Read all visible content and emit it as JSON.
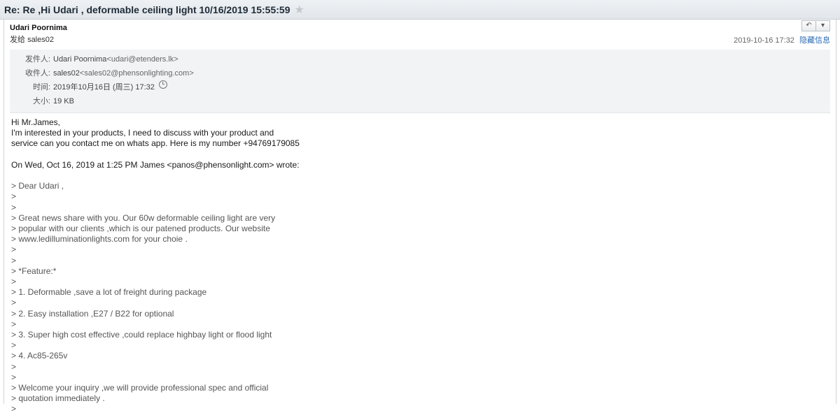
{
  "subject": "Re: Re ,Hi Udari , deformable ceiling light 10/16/2019 15:55:59",
  "header": {
    "from_name": "Udari Poornima",
    "sendto_label": "发给",
    "sendto_value": "sales02",
    "datetime": "2019-10-16 17:32",
    "hide_link": "隐藏信息"
  },
  "details": {
    "from_label": "发件人:",
    "from_name": "Udari Poornima",
    "from_email": "<udari@etenders.lk>",
    "to_label": "收件人:",
    "to_name": "sales02",
    "to_email": "<sales02@phensonlighting.com>",
    "time_label": "时间:",
    "time_value": "2019年10月16日 (周三) 17:32",
    "size_label": "大小:",
    "size_value": "19 KB"
  },
  "icons": {
    "reply": "reply-icon",
    "reply_all": "reply-all-icon",
    "star": "star-icon",
    "clock": "clock-icon"
  },
  "body": {
    "lines": [
      "Hi Mr.James,",
      "I'm interested in your products, I need to discuss with your product and",
      "service can you contact me on whats app. Here is my number +94769179085",
      "",
      "On Wed, Oct 16, 2019 at 1:25 PM James <panos@phensonlight.com> wrote:",
      ""
    ],
    "quote_lines": [
      "> Dear Udari ,",
      ">",
      ">",
      "> Great news share with you. Our 60w deformable ceiling light are very",
      "> popular with our clients ,which is our patened products. Our website",
      "> www.ledilluminationlights.com for your choie .",
      ">",
      ">",
      "> *Feature:*",
      ">",
      "> 1. Deformable ,save a lot of freight during package",
      ">",
      "> 2. Easy installation ,E27 / B22 for optional",
      ">",
      "> 3. Super high cost effective ,could replace highbay light or flood light",
      ">",
      "> 4. Ac85-265v",
      ">",
      ">",
      "> Welcome your inquiry ,we will provide professional spec and official",
      "> quotation immediately .",
      ">"
    ]
  }
}
